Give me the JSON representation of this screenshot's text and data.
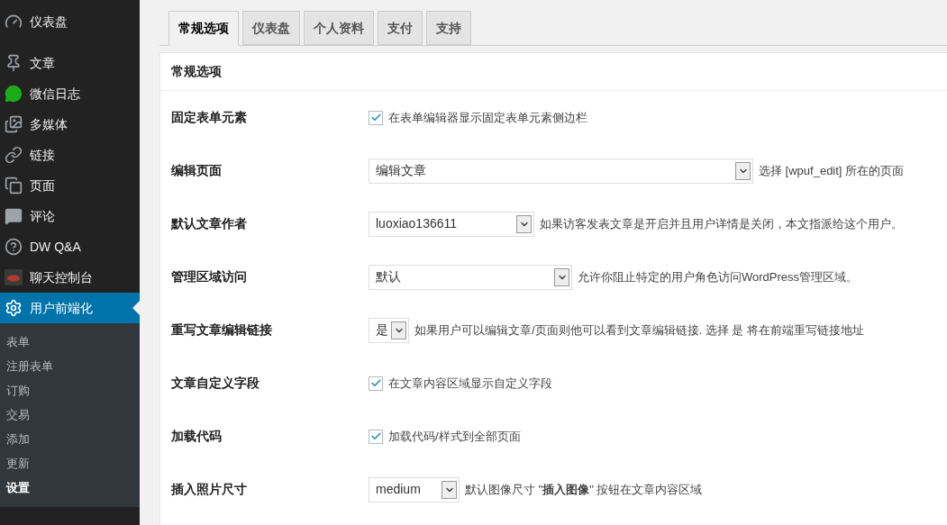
{
  "sidebar": {
    "items": [
      {
        "label": "仪表盘",
        "selected": false
      },
      {
        "label": "文章",
        "selected": false
      },
      {
        "label": "微信日志",
        "selected": false
      },
      {
        "label": "多媒体",
        "selected": false
      },
      {
        "label": "链接",
        "selected": false
      },
      {
        "label": "页面",
        "selected": false
      },
      {
        "label": "评论",
        "selected": false
      },
      {
        "label": "DW Q&A",
        "selected": false
      },
      {
        "label": "聊天控制台",
        "selected": false
      },
      {
        "label": "用户前端化",
        "selected": true,
        "children": [
          {
            "label": "表单",
            "selected": false
          },
          {
            "label": "注册表单",
            "selected": false
          },
          {
            "label": "订购",
            "selected": false
          },
          {
            "label": "交易",
            "selected": false
          },
          {
            "label": "添加",
            "selected": false
          },
          {
            "label": "更新",
            "selected": false
          },
          {
            "label": "设置",
            "selected": true
          }
        ]
      }
    ]
  },
  "tabs": [
    {
      "label": "常规选项",
      "selected": true
    },
    {
      "label": "仪表盘",
      "selected": false
    },
    {
      "label": "个人资料",
      "selected": false
    },
    {
      "label": "支付",
      "selected": false
    },
    {
      "label": "支持",
      "selected": false
    }
  ],
  "section": {
    "title": "常规选项"
  },
  "settings": [
    {
      "label": "固定表单元素",
      "kind": "checkbox",
      "checked": true,
      "description": "在表单编辑器显示固定表单元素侧边栏"
    },
    {
      "label": "编辑页面",
      "kind": "select",
      "value": "编辑文章",
      "description": "选择 [wpuf_edit] 所在的页面"
    },
    {
      "label": "默认文章作者",
      "kind": "select",
      "value": "luoxiao136611",
      "description": "如果访客发表文章是开启并且用户详情是关闭，本文指派给这个用户。"
    },
    {
      "label": "管理区域访问",
      "kind": "select",
      "value": "默认",
      "description": "允许你阻止特定的用户角色访问WordPress管理区域。"
    },
    {
      "label": "重写文章编辑链接",
      "kind": "select",
      "value": "是",
      "description": "如果用户可以编辑文章/页面则他可以看到文章编辑链接. 选择 是 将在前端重写链接地址"
    },
    {
      "label": "文章自定义字段",
      "kind": "checkbox",
      "checked": true,
      "description": "在文章内容区域显示自定义字段"
    },
    {
      "label": "加载代码",
      "kind": "checkbox",
      "checked": true,
      "description": "加载代码/样式到全部页面"
    },
    {
      "label": "插入照片尺寸",
      "kind": "select",
      "value": "medium",
      "description": "默认图像尺寸 \"**插入图像**\" 按钮在文章内容区域"
    }
  ]
}
